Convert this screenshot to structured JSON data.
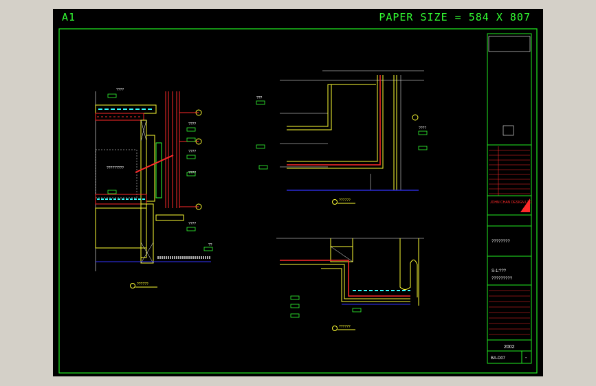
{
  "sheet": {
    "label": "A1",
    "paper_size": "PAPER SIZE = 584 X 807"
  },
  "colors": {
    "frame": "#22ee22",
    "yellow": "#ffff33",
    "red": "#ff2a2a",
    "blue": "#3333ff",
    "white": "#ffffff",
    "cyan": "#33ffff"
  },
  "title_block": {
    "year": "2002",
    "drawing_no": "BA-D07",
    "rev": "-",
    "company": "JOHN CHAN DESIGN LTD",
    "scale_text": "S-1:???",
    "name_text": "????????",
    "desc_text": "?????????"
  },
  "details": [
    {
      "label": "??????"
    },
    {
      "label": "??????"
    },
    {
      "label": "??????"
    }
  ],
  "annotations": [
    "????",
    "????",
    "????",
    "????",
    "????",
    "?????????",
    "???",
    "????",
    "??"
  ]
}
